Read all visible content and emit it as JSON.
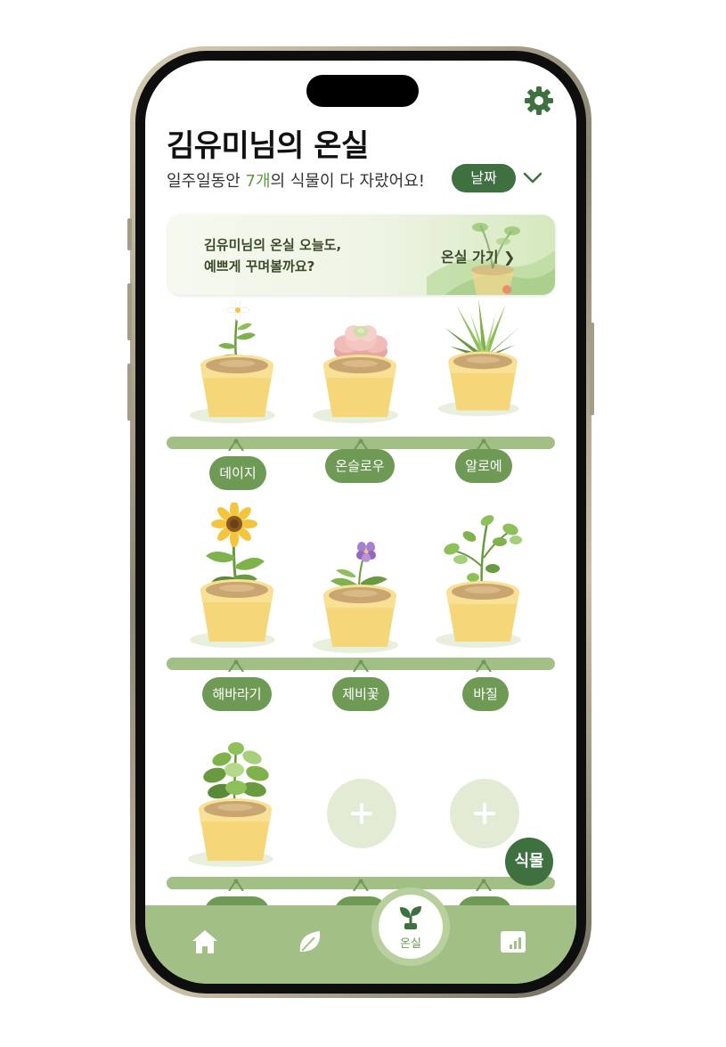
{
  "header": {
    "title": "김유미님의 온실",
    "subtitle_prefix": "일주일동안 ",
    "subtitle_count": "7개",
    "subtitle_suffix": "의 식물이 다 자랐어요!",
    "date_button": "날짜"
  },
  "banner": {
    "line1": "김유미님의 온실 오늘도,",
    "line2": "예쁘게 꾸며볼까요?",
    "link": "온실 가기 ❯"
  },
  "shelves": [
    {
      "plants": [
        {
          "name": "데이지",
          "icon": "daisy-plant"
        },
        {
          "name": "온슬로우",
          "icon": "succulent-plant"
        },
        {
          "name": "알로에",
          "icon": "aloe-plant"
        }
      ]
    },
    {
      "plants": [
        {
          "name": "해바라기",
          "icon": "sunflower-plant"
        },
        {
          "name": "제비꽃",
          "icon": "violet-plant"
        },
        {
          "name": "바질",
          "icon": "basil-plant"
        }
      ]
    },
    {
      "plants": [
        {
          "name": "",
          "icon": "leafy-plant"
        },
        {
          "name": "",
          "icon": "add-plant-icon"
        },
        {
          "name": "",
          "icon": "add-plant-icon"
        }
      ]
    }
  ],
  "fab": {
    "label": "식물"
  },
  "bottom_nav": {
    "items": [
      {
        "icon": "home-icon",
        "label": ""
      },
      {
        "icon": "leaf-icon",
        "label": ""
      },
      {
        "icon": "sprout-icon",
        "label": "온실"
      },
      {
        "icon": "chart-icon",
        "label": ""
      }
    ]
  },
  "colors": {
    "primary_dark": "#3e7040",
    "primary": "#6f9a55",
    "shelf": "#a2bf85",
    "highlight_text": "#5f9a47",
    "add_button_bg": "#e2ebd3"
  }
}
